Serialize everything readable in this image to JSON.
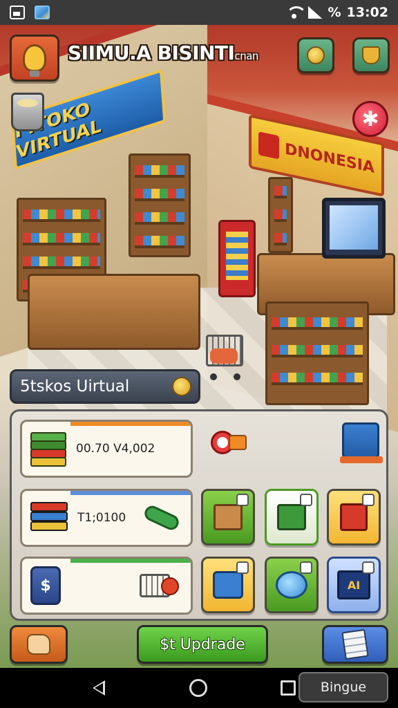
{
  "status_bar": {
    "time": "13:02",
    "battery_label": "%",
    "icons": [
      "gallery-icon",
      "photo-icon",
      "wifi-icon",
      "signal-icon"
    ]
  },
  "hud": {
    "title_main": "SIIMU.A BISINTI",
    "title_small": "cnan",
    "left_icon": "lightbulb-icon",
    "right_icons": [
      "coin-icon",
      "trophy-icon"
    ],
    "side_icons": [
      "bin-icon",
      "star-icon"
    ]
  },
  "scene": {
    "sign_left": "I ITOKO VIRTUAL",
    "sign_right": "DNONESIA"
  },
  "store_plate": {
    "label": "5tskos Uirtual"
  },
  "panel": {
    "stat_money": "00.70 V4,002",
    "stat_goods": "T1;0100",
    "stat_jar_symbol": "$",
    "tile_screen_text": "AI"
  },
  "buttons": {
    "upgrade_label": "$t Updrade"
  },
  "nav": {
    "pill_label": "Bingue"
  },
  "colors": {
    "brand_red": "#c14223",
    "upgrade_green": "#3b9a1e",
    "panel_bg": "#e6e1d9",
    "accent_blue": "#2f5fba"
  }
}
